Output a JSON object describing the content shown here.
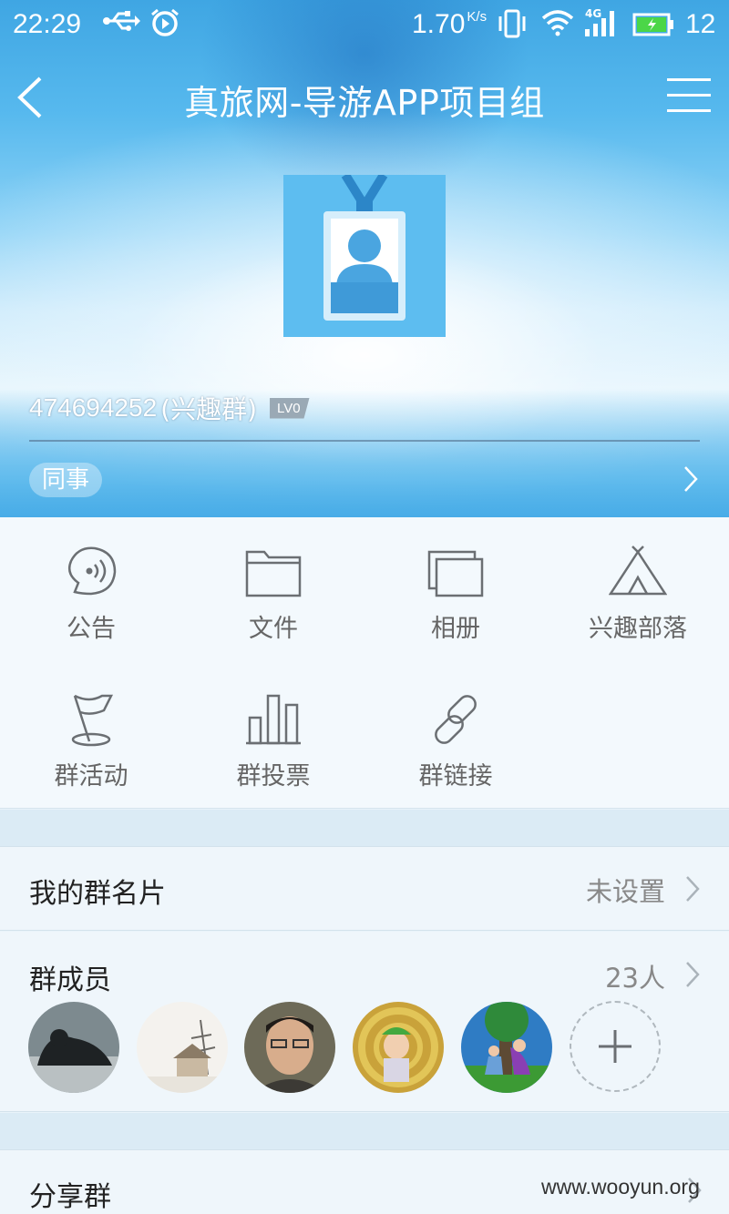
{
  "status_bar": {
    "time": "22:29",
    "net_speed": "1.70",
    "net_speed_unit": "K/s",
    "network_type": "4G",
    "battery": "12"
  },
  "nav": {
    "title": "真旅网-导游APP项目组"
  },
  "group": {
    "id": "474694252",
    "type": "(兴趣群)",
    "level": "LV0",
    "tag": "同事"
  },
  "functions": [
    {
      "label": "公告",
      "icon": "announcement-icon"
    },
    {
      "label": "文件",
      "icon": "folder-icon"
    },
    {
      "label": "相册",
      "icon": "album-icon"
    },
    {
      "label": "兴趣部落",
      "icon": "tent-icon"
    },
    {
      "label": "群活动",
      "icon": "flag-icon"
    },
    {
      "label": "群投票",
      "icon": "bar-chart-icon"
    },
    {
      "label": "群链接",
      "icon": "link-icon"
    }
  ],
  "my_card": {
    "label": "我的群名片",
    "value": "未设置"
  },
  "members": {
    "label": "群成员",
    "count": "23人"
  },
  "share": {
    "label": "分享群"
  },
  "watermark": "www.wooyun.org",
  "colors": {
    "header_blue": "#4aaee8",
    "icon_gray": "#6b6f73",
    "accent": "#5fbef0"
  }
}
